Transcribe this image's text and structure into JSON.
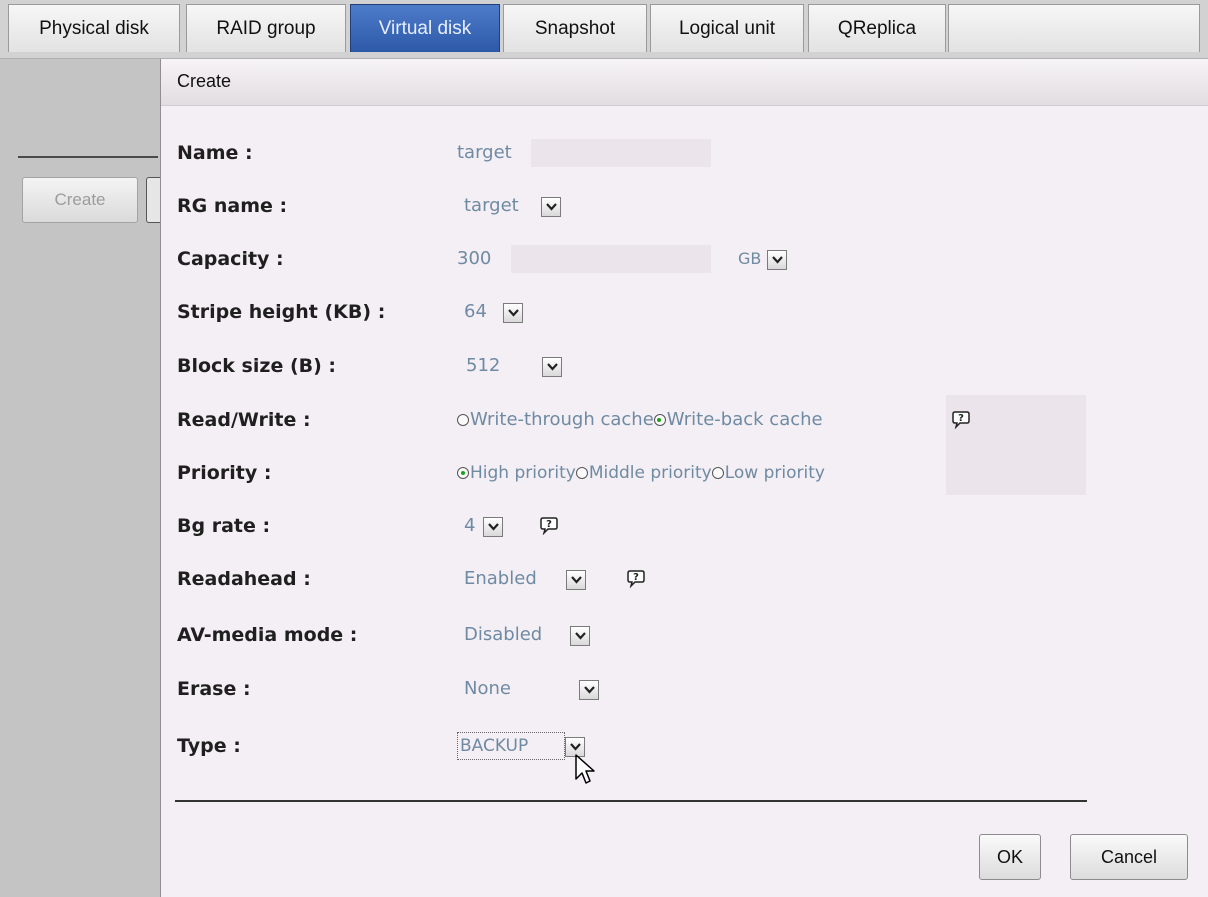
{
  "tabs": [
    {
      "label": "Physical disk",
      "active": false
    },
    {
      "label": "RAID group",
      "active": false
    },
    {
      "label": "Virtual disk",
      "active": true
    },
    {
      "label": "Snapshot",
      "active": false
    },
    {
      "label": "Logical unit",
      "active": false
    },
    {
      "label": "QReplica",
      "active": false
    }
  ],
  "sidebar": {
    "create_label": "Create"
  },
  "panel": {
    "title": "Create"
  },
  "form": {
    "name": {
      "label": "Name :",
      "value": "target"
    },
    "rg_name": {
      "label": "RG name :",
      "value": "target"
    },
    "capacity": {
      "label": "Capacity :",
      "value": "300",
      "unit": "GB"
    },
    "stripe_height": {
      "label": "Stripe height (KB) :",
      "value": "64"
    },
    "block_size": {
      "label": "Block size (B) :",
      "value": "512"
    },
    "read_write": {
      "label": "Read/Write :",
      "options": [
        {
          "label": "Write-through cache",
          "selected": false
        },
        {
          "label": "Write-back cache",
          "selected": true
        }
      ]
    },
    "priority": {
      "label": "Priority :",
      "options": [
        {
          "label": "High priority",
          "selected": true
        },
        {
          "label": "Middle priority",
          "selected": false
        },
        {
          "label": "Low priority",
          "selected": false
        }
      ]
    },
    "bg_rate": {
      "label": "Bg rate :",
      "value": "4"
    },
    "readahead": {
      "label": "Readahead :",
      "value": "Enabled"
    },
    "av_media_mode": {
      "label": "AV-media mode :",
      "value": "Disabled"
    },
    "erase": {
      "label": "Erase :",
      "value": "None"
    },
    "type": {
      "label": "Type :",
      "value": "BACKUP"
    }
  },
  "buttons": {
    "ok": "OK",
    "cancel": "Cancel"
  },
  "icons": {
    "dropdown": "chevron-down-icon",
    "help": "help-icon",
    "cursor": "mouse-pointer-icon"
  },
  "colors": {
    "active_tab": "#3a66b5",
    "value_text": "#6f8aa3",
    "radio_selected": "#1aa31a"
  }
}
